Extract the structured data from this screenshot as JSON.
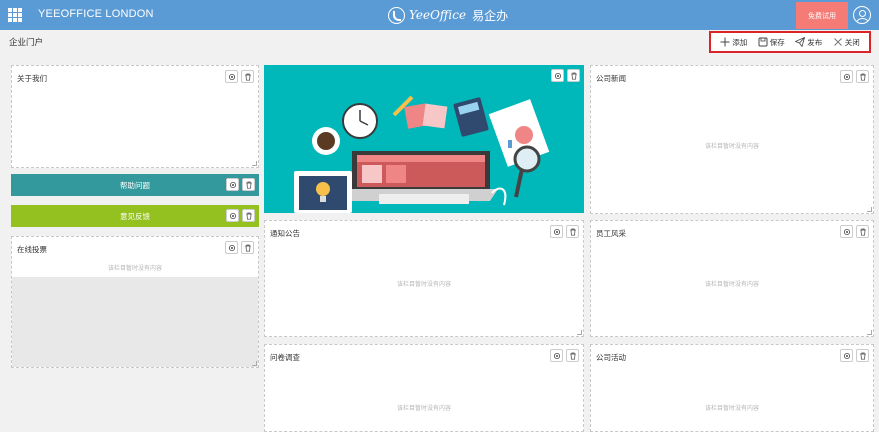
{
  "topbar": {
    "org_name": "YEEOFFICE LONDON",
    "brand_en": "YeeOffice",
    "brand_cn": "易企办",
    "trial_label": "免费试用",
    "colors": {
      "bar": "#5b9bd5",
      "trial": "#f47b76"
    }
  },
  "page": {
    "title": "企业门户"
  },
  "toolbar": {
    "add_label": "添加",
    "save_label": "保存",
    "publish_label": "发布",
    "close_label": "关闭"
  },
  "panels": {
    "about": {
      "title": "关于我们"
    },
    "help": {
      "title": "帮助问题",
      "color": "#33999c"
    },
    "feedback": {
      "title": "意见反馈",
      "color": "#94c11f"
    },
    "vote": {
      "title": "在线投票",
      "empty": "该栏目暂时没有内容"
    },
    "news": {
      "title": "公司新闻",
      "empty": "该栏目暂时没有内容"
    },
    "notice": {
      "title": "通知公告",
      "empty": "该栏目暂时没有内容"
    },
    "staff": {
      "title": "员工风采",
      "empty": "该栏目暂时没有内容"
    },
    "survey": {
      "title": "问卷调查",
      "empty": "该栏目暂时没有内容"
    },
    "activity": {
      "title": "公司活动",
      "empty": "该栏目暂时没有内容"
    }
  },
  "icons": {
    "settings": "gear-icon",
    "delete": "trash-icon",
    "add": "plus-icon",
    "save": "save-icon",
    "publish": "paper-plane-icon",
    "close": "close-icon"
  }
}
